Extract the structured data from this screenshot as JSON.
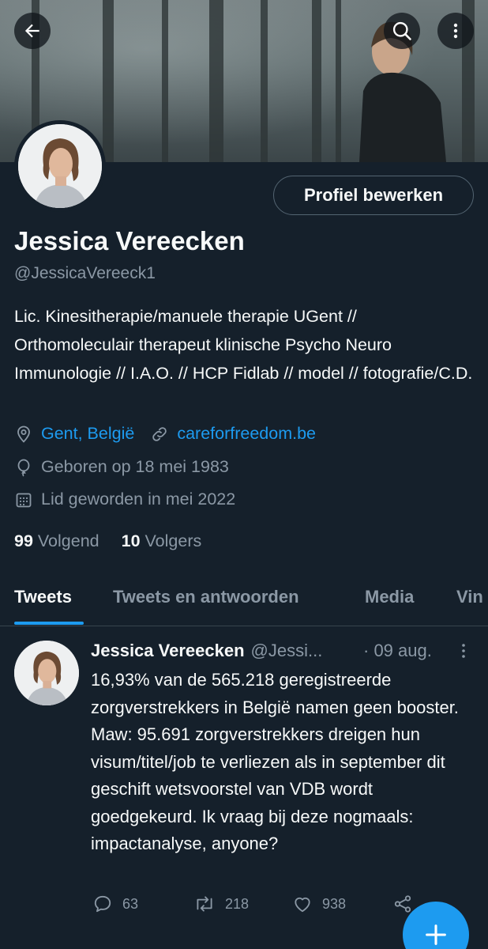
{
  "header": {
    "back_icon": "arrow-left-icon",
    "search_icon": "search-icon",
    "more_icon": "more-vertical-icon"
  },
  "profile": {
    "edit_label": "Profiel bewerken",
    "name": "Jessica Vereecken",
    "handle": "@JessicaVereeck1",
    "bio": "Lic. Kinesitherapie/manuele therapie UGent // Orthomoleculair therapeut klinische Psycho Neuro Immunologie // I.A.O. // HCP Fidlab // model // fotografie/C.D.",
    "location": "Gent, België",
    "website": "careforfreedom.be",
    "birth": "Geboren op 18 mei 1983",
    "joined": "Lid geworden in mei 2022",
    "following_count": "99",
    "following_label": "Volgend",
    "followers_count": "10",
    "followers_label": "Volgers"
  },
  "tabs": [
    {
      "label": "Tweets",
      "active": true
    },
    {
      "label": "Tweets en antwoorden",
      "active": false
    },
    {
      "label": "Media",
      "active": false
    },
    {
      "label": "Vin",
      "active": false
    }
  ],
  "tweet": {
    "name": "Jessica Vereecken",
    "handle": "@Jessi...",
    "date": "· 09 aug.",
    "text": "16,93% van de 565.218 geregistreerde zorgverstrekkers in België namen geen booster.\nMaw: 95.691 zorgverstrekkers dreigen hun visum/titel/job te verliezen als in september dit geschift wetsvoorstel van VDB wordt goedgekeurd. Ik vraag bij deze nogmaals: impactanalyse, anyone?",
    "replies": "63",
    "retweets": "218",
    "likes": "938"
  },
  "colors": {
    "background": "#15202b",
    "accent": "#1d9bf0",
    "secondary_text": "#8b98a5",
    "border": "#38444d"
  }
}
